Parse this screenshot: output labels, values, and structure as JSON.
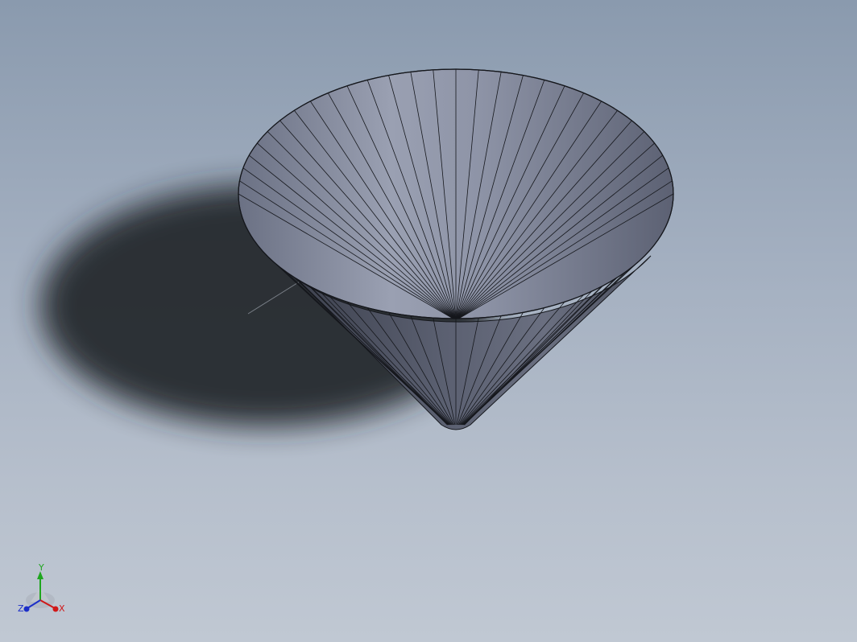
{
  "viewport": {
    "background_top": "#8a9aae",
    "background_bottom": "#c0c8d3"
  },
  "model": {
    "shape": "cone",
    "face_color": "#8c93a6",
    "edge_color": "#15171c",
    "shadow_color": "#23262b"
  },
  "triad": {
    "x_label": "X",
    "y_label": "Y",
    "z_label": "Z",
    "x_color": "#d01818",
    "y_color": "#1fa61f",
    "z_color": "#1c2fc8"
  }
}
